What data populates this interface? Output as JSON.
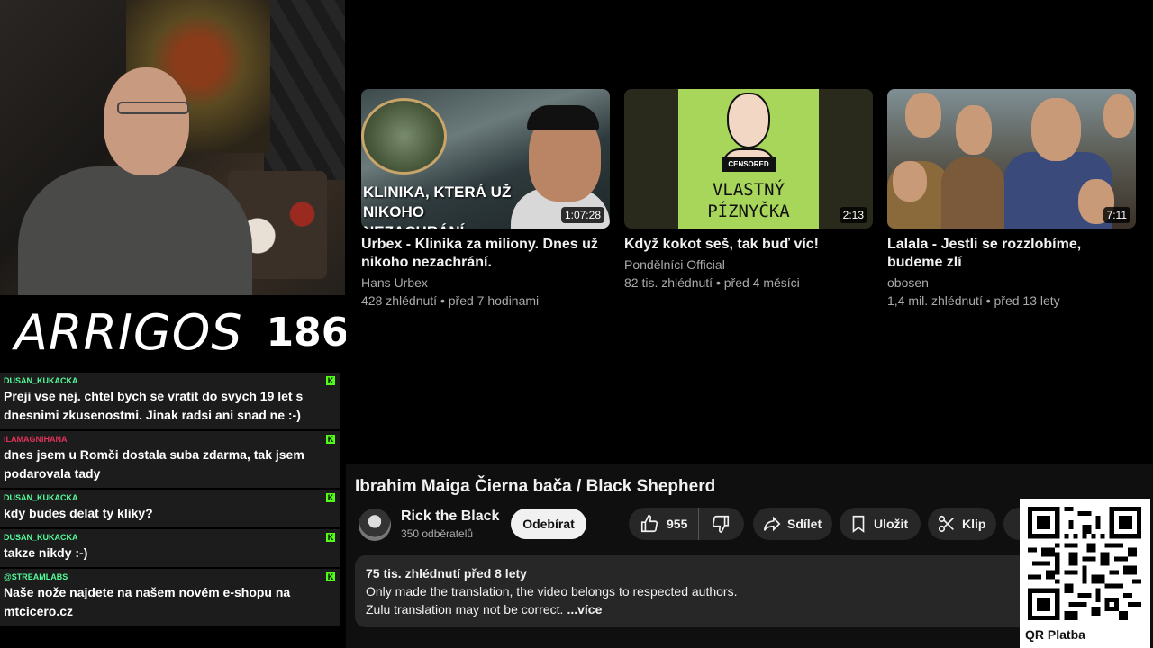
{
  "stream_overlay": {
    "logo_text": "ARRIGOS",
    "logo_number": "186"
  },
  "chat": {
    "messages": [
      {
        "user": "DUSAN_KUKACKA",
        "user_color": "#53fc9a",
        "text": "Preji vse nej. chtel bych se vratit do svych 19 let s dnesnimi zkusenostmi. Jinak radsi ani snad ne :-)"
      },
      {
        "user": "ILAMAGNIHANA",
        "user_color": "#e0335a",
        "text": "dnes jsem u Romči dostala suba zdarma, tak jsem podarovala tady"
      },
      {
        "user": "DUSAN_KUKACKA",
        "user_color": "#53fc9a",
        "text": "kdy budes delat ty kliky?"
      },
      {
        "user": "DUSAN_KUKACKA",
        "user_color": "#53fc9a",
        "text": "takze nikdy :-)"
      },
      {
        "user": "@STREAMLABS",
        "user_color": "#53fc9a",
        "text": "Naše nože najdete na našem novém e-shopu na mtcicero.cz"
      }
    ],
    "badge_glyph": "K"
  },
  "recommendations": [
    {
      "thumb_text": "KLINIKA, KTERÁ UŽ NIKOHO NEZACHRÁNÍ",
      "duration": "1:07:28",
      "title": "Urbex - Klinika za miliony. Dnes už nikoho nezachrání.",
      "channel": "Hans Urbex",
      "meta": "428 zhlédnutí • před 7 hodinami"
    },
    {
      "thumb_text": "VLASTNÝ PÍZNYČKA",
      "censor_text": "CENSORED",
      "duration": "2:13",
      "title": "Když kokot seš, tak buď víc!",
      "channel": "Pondělníci Official",
      "meta": "82 tis. zhlédnutí • před 4 měsíci"
    },
    {
      "duration": "7:11",
      "title": "Lalala - Jestli se rozzlobíme, budeme zlí",
      "channel": "obosen",
      "meta": "1,4 mil. zhlédnutí • před 13 lety"
    }
  ],
  "video": {
    "title": "Ibrahim Maiga Čierna bača / Black Shepherd",
    "channel_name": "Rick the Black",
    "channel_subs": "350 odběratelů",
    "subscribe_label": "Odebírat",
    "like_count": "955",
    "share_label": "Sdílet",
    "save_label": "Uložit",
    "clip_label": "Klip",
    "description": {
      "stats": "75 tis. zhlédnutí  před 8 lety",
      "line1": "Only made the translation, the video belongs to respected authors.",
      "line2": "Zulu translation may not be correct.",
      "more": "...více"
    }
  },
  "qr": {
    "label": "QR Platba"
  },
  "colors": {
    "youtube_bg": "#0f0f0f",
    "pill_bg": "#272727",
    "kick_green": "#53fc18"
  }
}
